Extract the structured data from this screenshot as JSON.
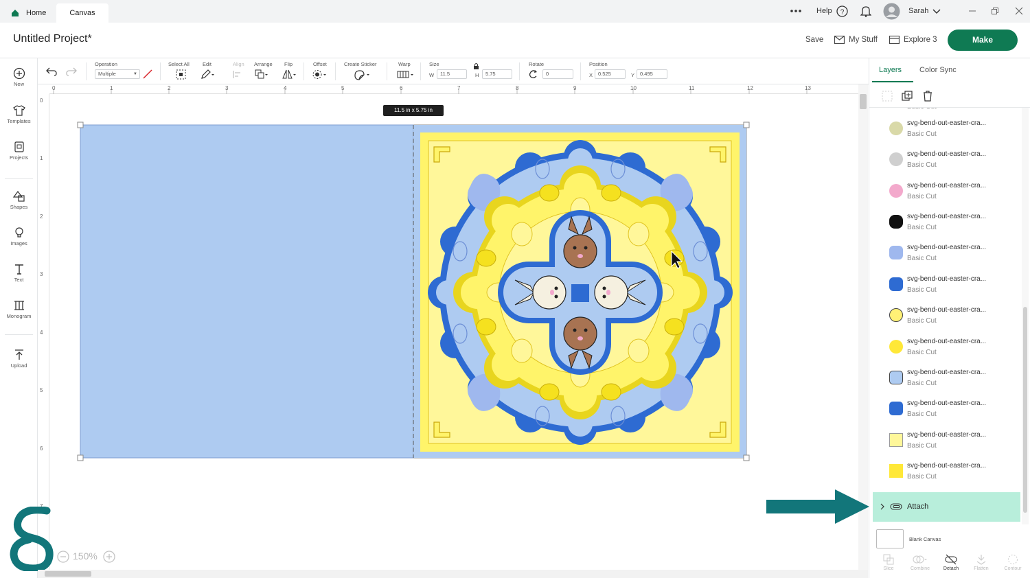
{
  "topbar": {
    "home_label": "Home",
    "canvas_label": "Canvas",
    "help_label": "Help",
    "user_name": "Sarah"
  },
  "header": {
    "project_title": "Untitled Project*",
    "save_label": "Save",
    "mystuff_label": "My Stuff",
    "explore_label": "Explore 3",
    "make_label": "Make",
    "make_color": "#0f7a53"
  },
  "toolbar": {
    "operation_label": "Operation",
    "operation_value": "Multiple",
    "select_all_label": "Select All",
    "edit_label": "Edit",
    "align_label": "Align",
    "arrange_label": "Arrange",
    "flip_label": "Flip",
    "offset_label": "Offset",
    "create_sticker_label": "Create Sticker",
    "warp_label": "Warp",
    "size_label": "Size",
    "w_label": "W",
    "w_value": "11.5",
    "h_label": "H",
    "h_value": "5.75",
    "rotate_label": "Rotate",
    "rotate_value": "0",
    "position_label": "Position",
    "x_label": "X",
    "x_value": "0.525",
    "y_label": "Y",
    "y_value": "0.495"
  },
  "leftbar": {
    "items": [
      {
        "label": "New",
        "icon": "plus-circle-icon"
      },
      {
        "label": "Templates",
        "icon": "tshirt-icon"
      },
      {
        "label": "Projects",
        "icon": "projects-icon"
      },
      {
        "label": "Shapes",
        "icon": "shapes-icon"
      },
      {
        "label": "Images",
        "icon": "lightbulb-icon"
      },
      {
        "label": "Text",
        "icon": "text-icon"
      },
      {
        "label": "Monogram",
        "icon": "monogram-icon"
      },
      {
        "label": "Upload",
        "icon": "upload-icon"
      }
    ]
  },
  "rulers": {
    "top": [
      "0",
      "1",
      "2",
      "3",
      "4",
      "5",
      "6",
      "7",
      "8",
      "9",
      "10",
      "11",
      "12",
      "13"
    ],
    "left": [
      "0",
      "1",
      "2",
      "3",
      "4",
      "5",
      "6",
      "7"
    ]
  },
  "canvas": {
    "size_tag": "11.5  in x 5.75  in",
    "zoom_label": "150%",
    "card_color": "#aecbf1",
    "yellow": "#fff46a",
    "light_yellow": "#fff79a",
    "blue": "#2e6bd2"
  },
  "rightpanel": {
    "tab_layers": "Layers",
    "tab_color_sync": "Color Sync",
    "layers": [
      {
        "name": "svg-bend-out-easter-cra...",
        "sub": "Basic Cut",
        "swatch": "#d9d9a8"
      },
      {
        "name": "svg-bend-out-easter-cra...",
        "sub": "Basic Cut",
        "swatch": "#cfcfcf"
      },
      {
        "name": "svg-bend-out-easter-cra...",
        "sub": "Basic Cut",
        "swatch": "#f3a9cc"
      },
      {
        "name": "svg-bend-out-easter-cra...",
        "sub": "Basic Cut",
        "swatch": "#111111"
      },
      {
        "name": "svg-bend-out-easter-cra...",
        "sub": "Basic Cut",
        "swatch": "#9fb8ee"
      },
      {
        "name": "svg-bend-out-easter-cra...",
        "sub": "Basic Cut",
        "swatch": "#2e6bd2"
      },
      {
        "name": "svg-bend-out-easter-cra...",
        "sub": "Basic Cut",
        "swatch": "#fff176"
      },
      {
        "name": "svg-bend-out-easter-cra...",
        "sub": "Basic Cut",
        "swatch": "#ffe838"
      },
      {
        "name": "svg-bend-out-easter-cra...",
        "sub": "Basic Cut",
        "swatch": "#aecbf1"
      },
      {
        "name": "svg-bend-out-easter-cra...",
        "sub": "Basic Cut",
        "swatch": "#2e6bd2"
      },
      {
        "name": "svg-bend-out-easter-cra...",
        "sub": "Basic Cut",
        "swatch": "#fff79a"
      },
      {
        "name": "svg-bend-out-easter-cra...",
        "sub": "Basic Cut",
        "swatch": "#ffe838"
      }
    ],
    "attach_label": "Attach",
    "blank_canvas_label": "Blank Canvas",
    "bottom_tools": [
      {
        "label": "Slice",
        "active": false
      },
      {
        "label": "Combine",
        "active": false
      },
      {
        "label": "Detach",
        "active": true
      },
      {
        "label": "Flatten",
        "active": false
      },
      {
        "label": "Contour",
        "active": false
      }
    ]
  }
}
